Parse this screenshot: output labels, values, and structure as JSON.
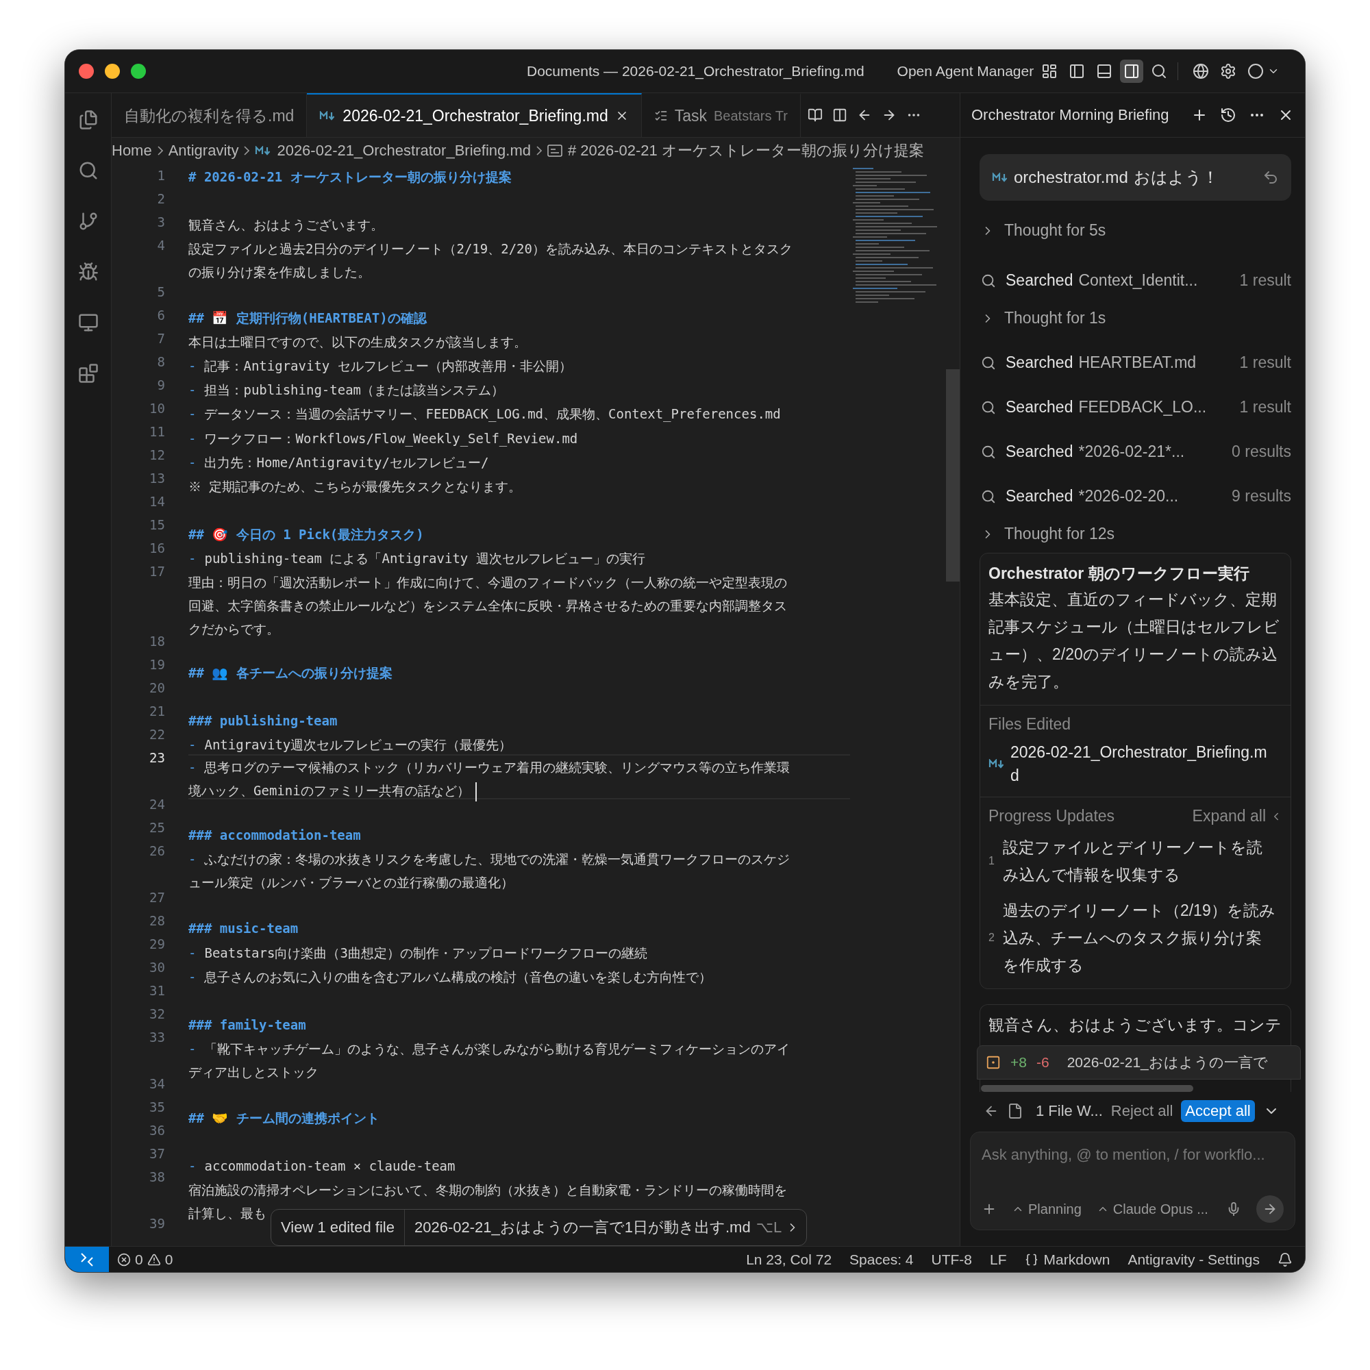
{
  "window": {
    "title": "Documents — 2026-02-21_Orchestrator_Briefing.md",
    "agent_manager": "Open Agent Manager"
  },
  "tabs": [
    {
      "label": "自動化の複利を得る.md",
      "kind": "file",
      "selected": false
    },
    {
      "label": "2026-02-21_Orchestrator_Briefing.md",
      "kind": "markdown",
      "selected": true
    },
    {
      "label": "Task",
      "detail": "Beatstars Tr",
      "kind": "task",
      "selected": false
    }
  ],
  "breadcrumb": [
    {
      "label": "Home",
      "kind": "folder"
    },
    {
      "label": "Antigravity",
      "kind": "folder"
    },
    {
      "label": "2026-02-21_Orchestrator_Briefing.md",
      "kind": "markdown"
    },
    {
      "label": "# 2026-02-21 オーケストレーター朝の振り分け提案",
      "kind": "symbol"
    }
  ],
  "editor": {
    "lines": [
      {
        "number": "1",
        "kind": "h1",
        "current": false,
        "parts": [
          "# 2026-02-21 オーケストレーター朝の振り分け提案"
        ]
      },
      {
        "number": "2",
        "current": false
      },
      {
        "number": "3",
        "kind": "text",
        "current": false,
        "parts": [
          "観音さん、おはようございます。"
        ]
      },
      {
        "number": "4",
        "kind": "text",
        "current": false,
        "parts": [
          "設定ファイルと過去2日分のデイリーノート（2/19、2/20）を読み込み、本日のコンテキストとタスク",
          "の振り分け案を作成しました。"
        ]
      },
      {
        "number": "5",
        "current": false
      },
      {
        "number": "6",
        "kind": "h2",
        "current": false,
        "parts": [
          "## 📅 定期刊行物(HEARTBEAT)の確認"
        ]
      },
      {
        "number": "7",
        "kind": "text",
        "current": false,
        "parts": [
          "本日は土曜日ですので、以下の生成タスクが該当します。"
        ]
      },
      {
        "number": "8",
        "kind": "bullet",
        "marker": "-",
        "current": false,
        "parts": [
          "記事：Antigravity セルフレビュー（内部改善用・非公開）"
        ]
      },
      {
        "number": "9",
        "kind": "bullet",
        "marker": "-",
        "current": false,
        "parts": [
          "担当：publishing-team（または該当システム）"
        ]
      },
      {
        "number": "10",
        "kind": "bullet",
        "marker": "-",
        "current": false,
        "parts": [
          "データソース：当週の会話サマリー、FEEDBACK_LOG.md、成果物、Context_Preferences.md"
        ]
      },
      {
        "number": "11",
        "kind": "bullet",
        "marker": "-",
        "current": false,
        "parts": [
          "ワークフロー：Workflows/Flow_Weekly_Self_Review.md"
        ]
      },
      {
        "number": "12",
        "kind": "bullet",
        "marker": "-",
        "current": false,
        "parts": [
          "出力先：Home/Antigravity/セルフレビュー/"
        ]
      },
      {
        "number": "13",
        "kind": "text",
        "current": false,
        "parts": [
          "※ 定期記事のため、こちらが最優先タスクとなります。"
        ]
      },
      {
        "number": "14",
        "current": false
      },
      {
        "number": "15",
        "kind": "h2",
        "current": false,
        "parts": [
          "## 🎯 今日の 1 Pick(最注力タスク)"
        ]
      },
      {
        "number": "16",
        "kind": "bullet",
        "marker": "-",
        "current": false,
        "parts": [
          "publishing-team による「Antigravity 週次セルフレビュー」の実行"
        ]
      },
      {
        "number": "17",
        "kind": "text",
        "current": false,
        "parts": [
          "理由：明日の「週次活動レポート」作成に向けて、今週のフィードバック（一人称の統一や定型表現の",
          "回避、太字箇条書きの禁止ルールなど）をシステム全体に反映・昇格させるための重要な内部調整タス",
          "クだからです。"
        ]
      },
      {
        "number": "18",
        "current": false
      },
      {
        "number": "19",
        "kind": "h2",
        "current": false,
        "parts": [
          "## 👥 各チームへの振り分け提案"
        ]
      },
      {
        "number": "20",
        "current": false
      },
      {
        "number": "21",
        "kind": "h3",
        "current": false,
        "parts": [
          "### publishing-team"
        ]
      },
      {
        "number": "22",
        "kind": "bullet",
        "marker": "-",
        "current": false,
        "parts": [
          "Antigravity週次セルフレビューの実行（最優先）"
        ]
      },
      {
        "number": "23",
        "kind": "bullet",
        "marker": "-",
        "current": true,
        "parts": [
          "思考ログのテーマ候補のストック（リカバリーウェア着用の継続実験、リングマウス等の立ち作業環",
          "境ハック、Geminiのファミリー共有の話など）"
        ]
      },
      {
        "number": "24",
        "current": false
      },
      {
        "number": "25",
        "kind": "h3",
        "current": false,
        "parts": [
          "### accommodation-team"
        ]
      },
      {
        "number": "26",
        "kind": "bullet",
        "marker": "-",
        "current": false,
        "parts": [
          "ふなだけの家：冬場の水抜きリスクを考慮した、現地での洗濯・乾燥一気通貫ワークフローのスケジ",
          "ュール策定（ルンバ・ブラーバとの並行稼働の最適化）"
        ]
      },
      {
        "number": "27",
        "current": false
      },
      {
        "number": "28",
        "kind": "h3",
        "current": false,
        "parts": [
          "### music-team"
        ]
      },
      {
        "number": "29",
        "kind": "bullet",
        "marker": "-",
        "current": false,
        "parts": [
          "Beatstars向け楽曲（3曲想定）の制作・アップロードワークフローの継続"
        ]
      },
      {
        "number": "30",
        "kind": "bullet",
        "marker": "-",
        "current": false,
        "parts": [
          "息子さんのお気に入りの曲を含むアルバム構成の検討（音色の違いを楽しむ方向性で）"
        ]
      },
      {
        "number": "31",
        "current": false
      },
      {
        "number": "32",
        "kind": "h3",
        "current": false,
        "parts": [
          "### family-team"
        ]
      },
      {
        "number": "33",
        "kind": "bullet",
        "marker": "-",
        "current": false,
        "parts": [
          "「靴下キャッチゲーム」のような、息子さんが楽しみながら動ける育児ゲーミフィケーションのアイ",
          "ディア出しとストック"
        ]
      },
      {
        "number": "34",
        "current": false
      },
      {
        "number": "35",
        "kind": "h2",
        "current": false,
        "parts": [
          "## 🤝 チーム間の連携ポイント"
        ]
      },
      {
        "number": "36",
        "current": false
      },
      {
        "number": "37",
        "kind": "bullet",
        "marker": "-",
        "current": false,
        "parts": [
          "accommodation-team × claude-team"
        ]
      },
      {
        "number": "38",
        "kind": "text",
        "current": false,
        "parts": [
          "宿泊施設の清掃オペレーションにおいて、冬期の制約（水抜き）と自動家電・ランドリーの稼働時間を",
          "計算し、最も"
        ]
      },
      {
        "number": "39",
        "current": false
      }
    ]
  },
  "popup": {
    "action": "View 1 edited file",
    "file": "2026-02-21_おはようの一言で1日が動き出す.md",
    "shortcut": "⌥L"
  },
  "panel": {
    "title": "Orchestrator Morning Briefing",
    "prompt": {
      "file": "orchestrator.md",
      "text": "おはよう！"
    },
    "activity": [
      {
        "kind": "thought",
        "label": "Thought for 5s"
      },
      {
        "kind": "search",
        "label": "Searched",
        "query": "Context_Identit...",
        "result": "1 result"
      },
      {
        "kind": "thought",
        "label": "Thought for 1s"
      },
      {
        "kind": "search",
        "label": "Searched",
        "query": "HEARTBEAT.md",
        "result": "1 result"
      },
      {
        "kind": "search",
        "label": "Searched",
        "query": "FEEDBACK_LO...",
        "result": "1 result"
      },
      {
        "kind": "search",
        "label": "Searched",
        "query": "*2026-02-21*...",
        "result": "0 results"
      },
      {
        "kind": "search",
        "label": "Searched",
        "query": "*2026-02-20...",
        "result": "9 results"
      },
      {
        "kind": "thought",
        "label": "Thought for 12s"
      }
    ],
    "card": {
      "title": "Orchestrator 朝のワークフロー実行",
      "body": "基本設定、直近のフィードバック、定期記事スケジュール（土曜日はセルフレビュー）、2/20のデイリーノートの読み込みを完了。",
      "files_heading": "Files Edited",
      "file": "2026-02-21_Orchestrator_Briefing.md",
      "progress_heading": "Progress Updates",
      "expand": "Expand all",
      "steps": [
        {
          "number": "1",
          "text": "設定ファイルとデイリーノートを読み込んで情報を収集する"
        },
        {
          "number": "2",
          "text": "過去のデイリーノート（2/19）を読み込み、チームへのタスク振り分け案を作成する"
        }
      ]
    },
    "message": "観音さん、おはようございます。コンテ",
    "diff": {
      "added": "+8",
      "removed": "-6",
      "file": "2026-02-21_おはようの一言で"
    },
    "review": {
      "summary": "1 File W...",
      "reject": "Reject all",
      "accept": "Accept all"
    },
    "input": {
      "placeholder": "Ask anything, @ to mention, / for workflo...",
      "mode": "Planning",
      "model": "Claude Opus ..."
    }
  },
  "status_bar": {
    "errors": "0",
    "warnings": "0",
    "position": "Ln 23, Col 72",
    "indent": "Spaces: 4",
    "encoding": "UTF-8",
    "eol": "LF",
    "language": "Markdown",
    "settings": "Antigravity - Settings"
  }
}
